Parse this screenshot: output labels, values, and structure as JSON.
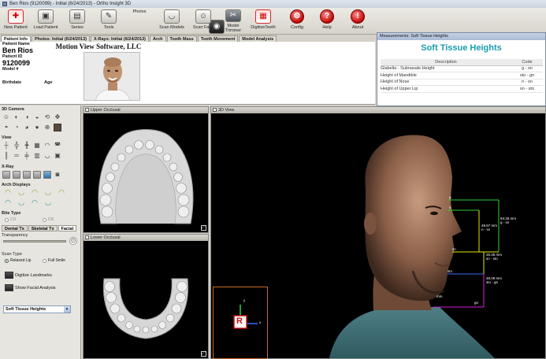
{
  "window": {
    "title": "Ben Rios (9120099) - Initial (6/24/2013) - Ortho Insight 3D"
  },
  "toolbar": {
    "buttons": [
      {
        "label": "New Patient",
        "icon": "new-patient-icon"
      },
      {
        "label": "Load Patient",
        "icon": "load-patient-icon"
      },
      {
        "label": "Series",
        "icon": "series-icon"
      },
      {
        "label": "Tools",
        "icon": "tools-icon"
      },
      {
        "label": "Photos",
        "icon": "camera-icon"
      },
      {
        "label": "Scan Models",
        "icon": "scan-models-icon"
      },
      {
        "label": "Scan Face",
        "icon": "scan-face-icon"
      },
      {
        "label": "Model Trimmer",
        "icon": "model-trimmer-icon"
      },
      {
        "label": "DigitizeTeeth",
        "icon": "digitize-teeth-icon"
      },
      {
        "label": "Config",
        "icon": "config-icon"
      },
      {
        "label": "Help",
        "icon": "help-icon"
      },
      {
        "label": "About",
        "icon": "about-icon"
      }
    ]
  },
  "tabs": [
    "Patient Info",
    "Photos: Initial (6/24/2013)",
    "X-Rays: Initial (6/24/2013)",
    "Arch",
    "Tooth Mass",
    "Tooth Movement",
    "Model Analysis"
  ],
  "patient": {
    "company": "Motion View Software, LLC",
    "name_label": "Patient Name",
    "name": "Ben Rios",
    "id_label": "Patient ID",
    "id": "9120099",
    "model_label": "Model #",
    "birthdate_label": "Birthdate",
    "age_label": "Age"
  },
  "measurements": {
    "window_title": "Measurements: Soft Tissue Heights",
    "heading": "Soft Tissue Heights",
    "columns": [
      "Description",
      "Code"
    ],
    "rows": [
      {
        "description": "Glabella - Subnasale Height",
        "code": "g - sn"
      },
      {
        "description": "Height of Mandible",
        "code": "sto - gn"
      },
      {
        "description": "Height of Nose",
        "code": "n - sn"
      },
      {
        "description": "Height of Upper Lip",
        "code": "sn - sto"
      }
    ]
  },
  "left_panel": {
    "camera_label": "3D Camera",
    "view_label": "View",
    "xray_label": "X-Ray",
    "arch_label": "Arch Displays",
    "bite_label": "Bite Type",
    "bite_options": [
      "CO",
      "CR"
    ],
    "subtabs": [
      "Dental Tx",
      "Skeletal Tx",
      "Facial"
    ],
    "transparency_label": "Transparency",
    "scan_type_label": "Scan Type",
    "scan_options": [
      "Relaxed Lip",
      "Full Smile"
    ],
    "digitize_label": "Digitize Landmarks",
    "show_facial_label": "Show Facial Analysis",
    "analysis_select": "Soft Tissue Heights"
  },
  "viewports": {
    "upper": "Upper Occlusal",
    "lower": "Lower Occlusal",
    "view3d": "3D View"
  },
  "overlay": {
    "labels": [
      "g",
      "n",
      "sn",
      "sto",
      "gn",
      "mm"
    ],
    "values": [
      "63.26 mm",
      "49.57 mm",
      "26.36 mm",
      "48.09 mm"
    ],
    "codes": [
      "g - sn",
      "n - sn",
      "sn - sto",
      "sto - gn"
    ]
  },
  "axis": {
    "x": "x",
    "y": "y",
    "r": "R"
  },
  "colors": {
    "toolbar_red": "#c60f0f",
    "heading_teal": "#1a9db0",
    "overlay_green": "#2fd12f",
    "overlay_yellow": "#e6e600",
    "overlay_magenta": "#d81ad8",
    "overlay_blue": "#3b6bff",
    "axis_border": "#c96a22"
  }
}
